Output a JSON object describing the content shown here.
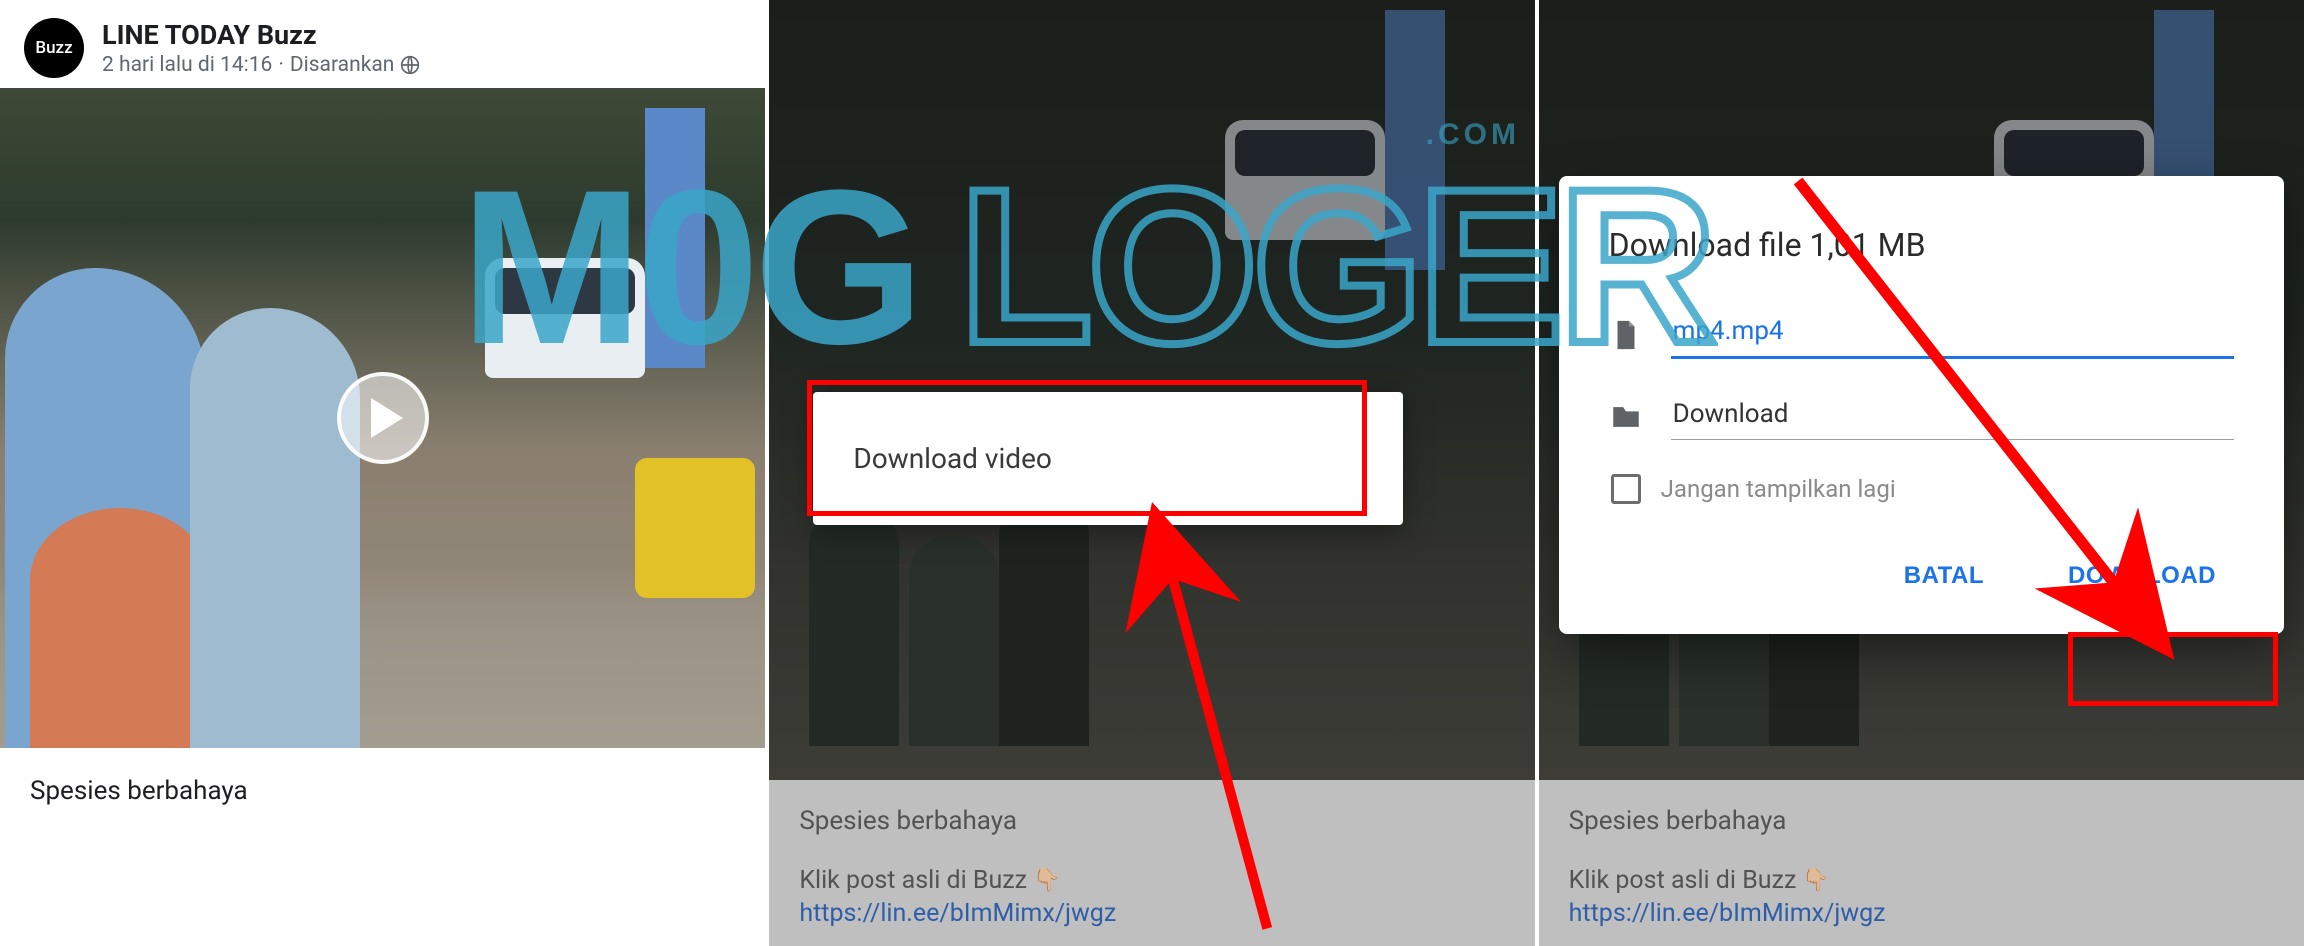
{
  "panel1": {
    "avatar_label": "Buzz",
    "source_name": "LINE TODAY Buzz",
    "time_text": "2 hari lalu di 14:16",
    "suggested_label": "Disarankan",
    "separator": " · ",
    "caption": "Spesies berbahaya"
  },
  "panel2": {
    "context_menu": {
      "download_video": "Download video"
    },
    "info": {
      "title": "Spesies berbahaya",
      "click_text": "Klik post asli di Buzz",
      "link": "https://lin.ee/bImMimx/jwgz"
    }
  },
  "panel3": {
    "dialog": {
      "title": "Download file 1,01 MB",
      "filename": "mp4.mp4",
      "folder": "Download",
      "dont_show": "Jangan tampilkan lagi",
      "cancel": "BATAL",
      "download": "DOWNLOAD"
    },
    "info": {
      "title": "Spesies berbahaya",
      "click_text": "Klik post asli di Buzz",
      "link": "https://lin.ee/bImMimx/jwgz"
    }
  },
  "watermark": {
    "left": "M0G",
    "right": "LOGER",
    "sub": ".COM"
  }
}
